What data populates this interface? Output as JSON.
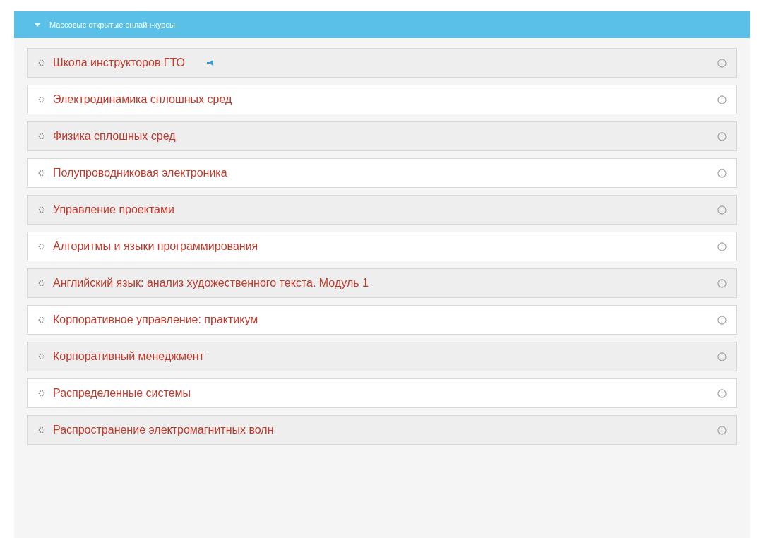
{
  "category": {
    "title": "Массовые открытые онлайн-курсы",
    "expanded": true
  },
  "courses": [
    {
      "title": "Школа инструкторов ГТО",
      "announcement": true
    },
    {
      "title": "Электродинамика сплошных сред",
      "announcement": false
    },
    {
      "title": "Физика сплошных сред",
      "announcement": false
    },
    {
      "title": "Полупроводниковая электроника",
      "announcement": false
    },
    {
      "title": "Управление проектами",
      "announcement": false
    },
    {
      "title": "Алгоритмы и языки программирования",
      "announcement": false
    },
    {
      "title": "Английский язык: анализ художественного текста. Модуль 1",
      "announcement": false
    },
    {
      "title": "Корпоративное управление: практикум",
      "announcement": false
    },
    {
      "title": "Корпоративный менеджмент",
      "announcement": false
    },
    {
      "title": "Распределенные системы",
      "announcement": false
    },
    {
      "title": "Распространение электромагнитных волн",
      "announcement": false
    }
  ]
}
